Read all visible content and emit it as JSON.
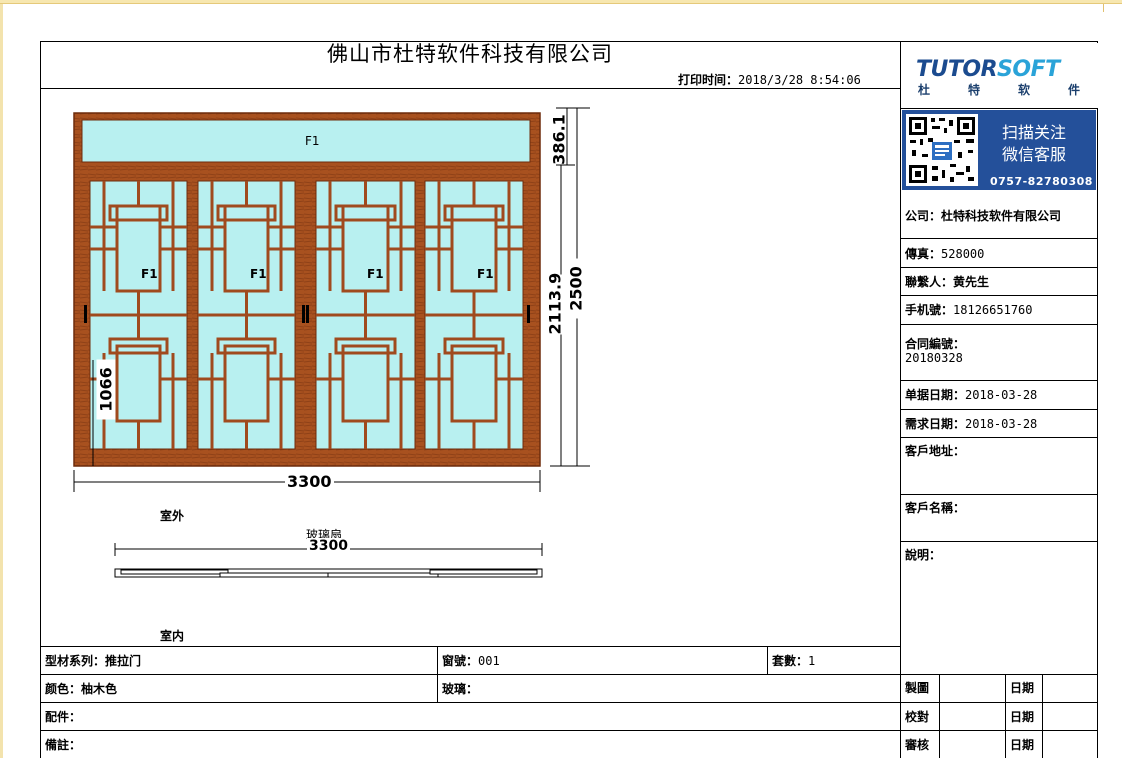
{
  "document": {
    "title": "佛山市杜特软件科技有限公司",
    "print_time_label": "打印时间：",
    "print_time_value": "2018/3/28 8:54:06"
  },
  "logo": {
    "brand_part1": "TUTOR",
    "brand_part2": "SOFT",
    "chinese_chars": [
      "杜",
      "特",
      "软",
      "件"
    ]
  },
  "qr_panel": {
    "line1": "扫描关注",
    "line2": "微信客服",
    "phone": "0757-82780308"
  },
  "info": {
    "company_label": "公司：",
    "company_value": "杜特科技软件有限公司",
    "fax_label": "傳真：",
    "fax_value": "528000",
    "contact_label": "聯繫人：",
    "contact_value": "黄先生",
    "mobile_label": "手机號：",
    "mobile_value": "18126651760",
    "contract_label": "合同編號：",
    "contract_value": "20180328",
    "doc_date_label": "单据日期：",
    "doc_date_value": "2018-03-28",
    "req_date_label": "需求日期：",
    "req_date_value": "2018-03-28",
    "address_label": "客戶地址：",
    "customer_label": "客戶名稱：",
    "note_label": "說明："
  },
  "drawing": {
    "pane_label": "F1",
    "width_dim": "3300",
    "height_total": "2500",
    "height_lower": "2113.9",
    "height_top": "386.1",
    "handle_height": "1066",
    "outside_label": "室外",
    "inside_label": "室内",
    "section_label": "玻璃扇",
    "section_width": "3300"
  },
  "footer": {
    "profile_label": "型材系列：",
    "profile_value": "推拉门",
    "window_no_label": "窗號：",
    "window_no_value": "001",
    "sets_label": "套數：",
    "sets_value": "1",
    "color_label": "颜色：",
    "color_value": "柚木色",
    "glass_label": "玻璃：",
    "accessories_label": "配件：",
    "remarks_label": "備註：",
    "draw_label": "製圖",
    "check_label": "校對",
    "review_label": "審核",
    "date_label": "日期"
  },
  "colors": {
    "wood": "#a04a1e",
    "wood_dark": "#6e2c0c",
    "glass": "#b8f0f0",
    "qr_blue": "#24509a"
  }
}
